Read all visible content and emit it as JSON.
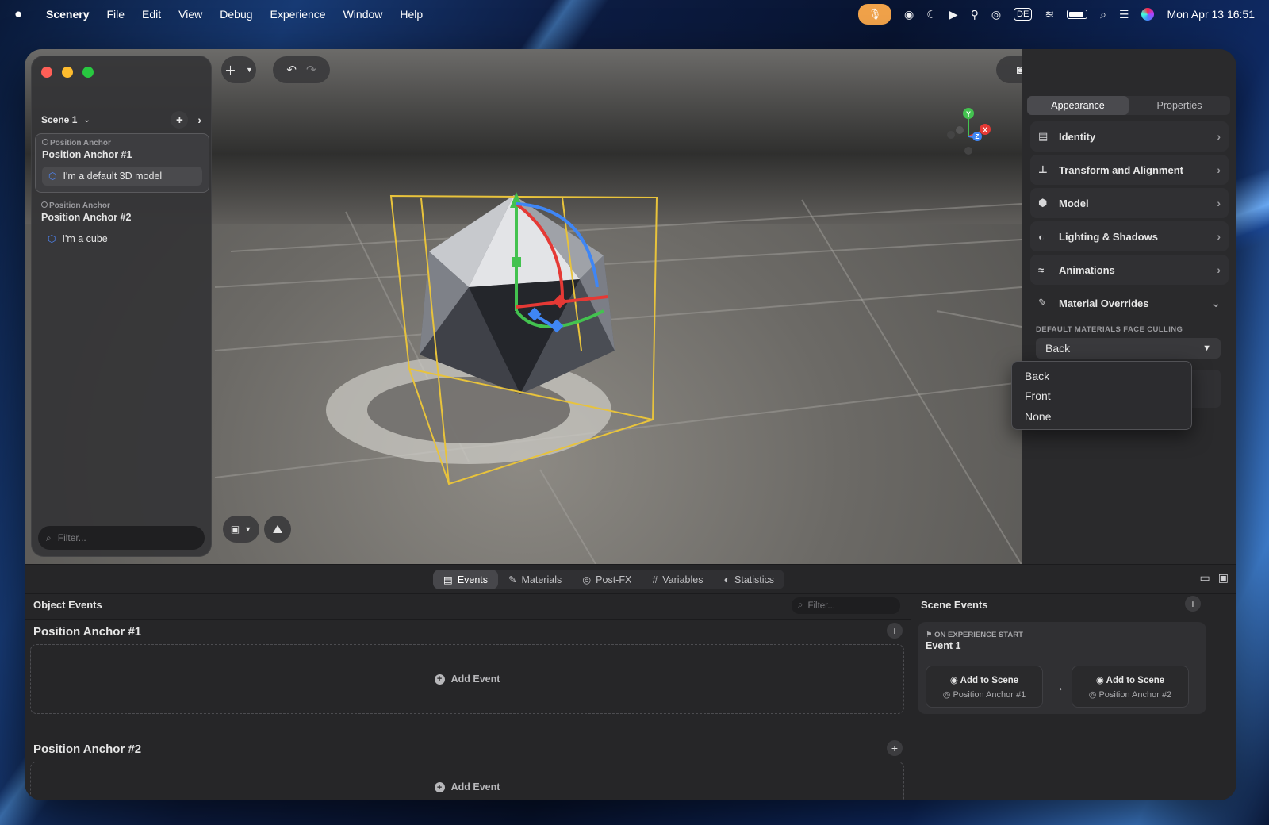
{
  "menubar": {
    "apple": "",
    "app_name": "Scenery",
    "menus": [
      "File",
      "Edit",
      "View",
      "Debug",
      "Experience",
      "Window",
      "Help"
    ],
    "input_source": "DE",
    "clock": "Mon Apr 13  16:51"
  },
  "sidebar": {
    "scene_title": "Scene 1",
    "anchors": [
      {
        "type": "Position Anchor",
        "name": "Position Anchor #1",
        "child": "I'm a default 3D model"
      },
      {
        "type": "Position Anchor",
        "name": "Position Anchor #2",
        "child": "I'm a cube"
      }
    ],
    "filter_placeholder": "Filter..."
  },
  "inspector": {
    "tabs": [
      "Appearance",
      "Properties"
    ],
    "active_tab": "Appearance",
    "sections": [
      {
        "label": "Identity",
        "icon": "id-card-icon"
      },
      {
        "label": "Transform and Alignment",
        "icon": "axes-icon"
      },
      {
        "label": "Model",
        "icon": "cube-icon"
      },
      {
        "label": "Lighting & Shadows",
        "icon": "half-circle-icon"
      },
      {
        "label": "Animations",
        "icon": "animation-icon"
      },
      {
        "label": "Material Overrides",
        "icon": "brush-icon"
      }
    ],
    "face_culling_caption": "DEFAULT MATERIALS FACE CULLING",
    "face_culling_value": "Back",
    "dropdown_options": [
      "Back",
      "Front",
      "None"
    ]
  },
  "gizmo_axes": {
    "y": "Y",
    "x": "X",
    "z": "Z"
  },
  "bottom": {
    "tabs": [
      {
        "label": "Events",
        "icon": "▤"
      },
      {
        "label": "Materials",
        "icon": "✎"
      },
      {
        "label": "Post-FX",
        "icon": "◎"
      },
      {
        "label": "Variables",
        "icon": "#"
      },
      {
        "label": "Statistics",
        "icon": "◐"
      }
    ],
    "object_events_title": "Object Events",
    "filter_placeholder": "Filter...",
    "anchor_sections": [
      {
        "title": "Position Anchor #1",
        "add_event": "Add Event"
      },
      {
        "title": "Position Anchor #2",
        "add_event": "Add Event"
      }
    ],
    "scene_events_title": "Scene Events",
    "event": {
      "kind": "ON EXPERIENCE START",
      "name": "Event 1",
      "actions": [
        {
          "title": "Add to Scene",
          "target": "Position Anchor #1"
        },
        {
          "title": "Add to Scene",
          "target": "Position Anchor #2"
        }
      ]
    }
  },
  "colors": {
    "accent_orange": "#f0a24a",
    "gizmo_red": "#e53935",
    "gizmo_green": "#43c24f",
    "gizmo_blue": "#3f86f5",
    "bounding_box": "#e8c33c"
  }
}
